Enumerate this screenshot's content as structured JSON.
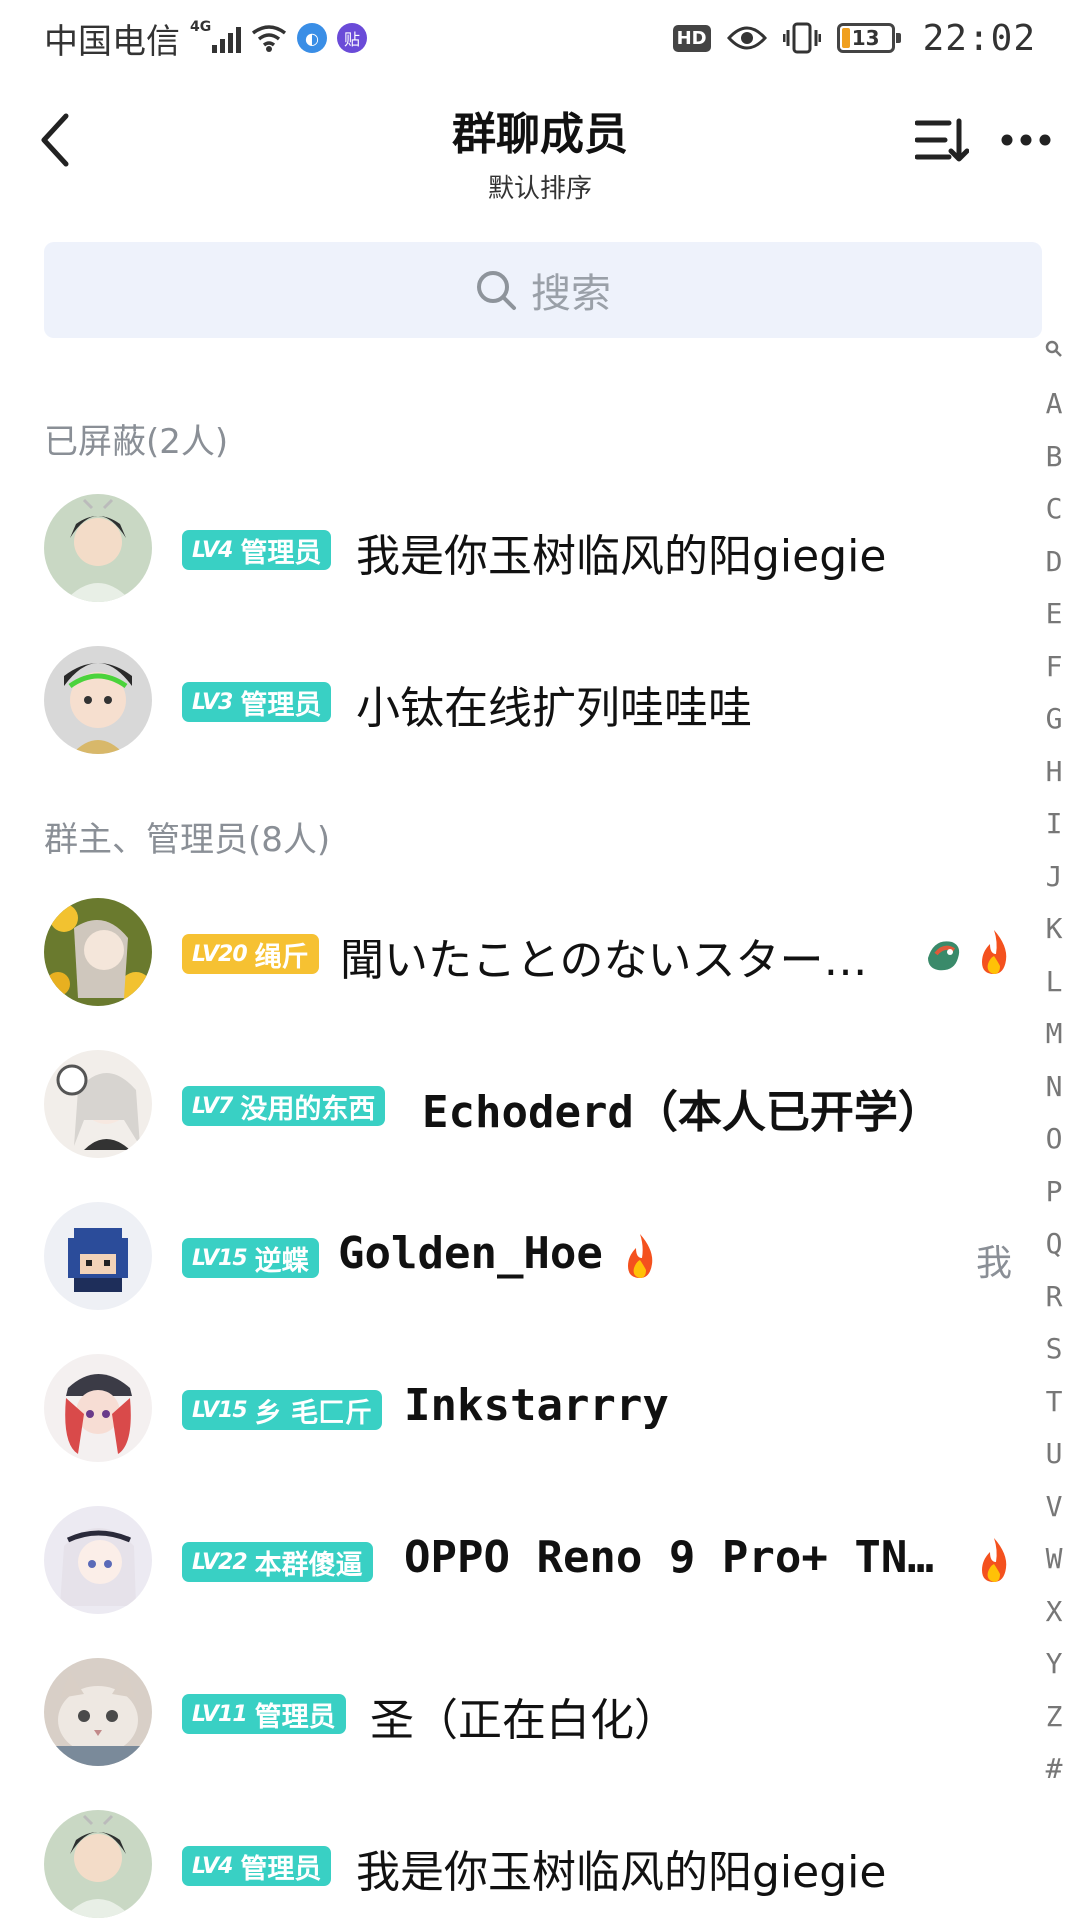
{
  "status_bar": {
    "carrier": "中国电信",
    "network": "4G",
    "time": "22:02",
    "battery": "13",
    "hd": "HD"
  },
  "header": {
    "title": "群聊成员",
    "subtitle": "默认排序"
  },
  "search": {
    "placeholder": "搜索"
  },
  "sections": [
    {
      "label": "已屏蔽(2人)"
    },
    {
      "label": "群主、管理员(8人)"
    }
  ],
  "members": [
    {
      "level": "LV4",
      "tag": "管理员",
      "name": "我是你玉树临风的阳giegie",
      "badge_color": "#39d0c4"
    },
    {
      "level": "LV3",
      "tag": "管理员",
      "name": "小钛在线扩列哇哇哇",
      "badge_color": "#39d0c4"
    },
    {
      "level": "LV20",
      "tag": "绳斤",
      "name": "聞いたことのないスター…",
      "badge_color": "#f6c132"
    },
    {
      "level": "LV7",
      "tag": "没用的东西",
      "name": "Echoderd（本人已开学）",
      "badge_color": "#39d0c4"
    },
    {
      "level": "LV15",
      "tag": "逆蝶",
      "name": "Golden_Hoe",
      "me": "我",
      "badge_color": "#39d0c4"
    },
    {
      "level": "LV15",
      "tag": "乡 毛匚斤",
      "name": "Inkstarrry",
      "badge_color": "#39d0c4"
    },
    {
      "level": "LV22",
      "tag": "本群傻逼",
      "name": "OPPO Reno 9 Pro+ TN…",
      "badge_color": "#39d0c4"
    },
    {
      "level": "LV11",
      "tag": "管理员",
      "name": "圣（正在白化）",
      "badge_color": "#39d0c4"
    },
    {
      "level": "LV4",
      "tag": "管理员",
      "name": "我是你玉树临风的阳giegie",
      "badge_color": "#39d0c4"
    }
  ],
  "alpha_index": [
    "A",
    "B",
    "C",
    "D",
    "E",
    "F",
    "G",
    "H",
    "I",
    "J",
    "K",
    "L",
    "M",
    "N",
    "O",
    "P",
    "Q",
    "R",
    "S",
    "T",
    "U",
    "V",
    "W",
    "X",
    "Y",
    "Z",
    "#"
  ],
  "icons": {
    "back": "chevron-left-icon",
    "sort": "sort-icon",
    "more": "more-dots-icon",
    "search": "search-icon",
    "flame": "flame-icon",
    "dragon": "dragon-icon"
  }
}
